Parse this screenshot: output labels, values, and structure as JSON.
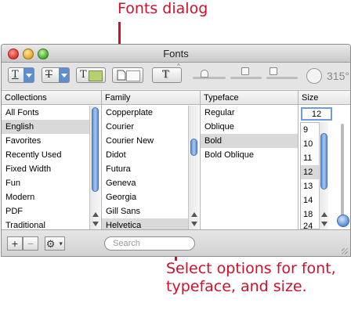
{
  "callouts": {
    "top": "Fonts dialog",
    "bottom_line1": "Select options for font,",
    "bottom_line2": "typeface, and size."
  },
  "window": {
    "title": "Fonts"
  },
  "toolbar": {
    "underline_glyph": "T",
    "strike_glyph": "T",
    "text_color_glyph": "T",
    "shadow_glyph": "T",
    "text_color_swatch": "#b3d36e",
    "angle_readout": "315°"
  },
  "columns": {
    "collections": {
      "header": "Collections",
      "items": [
        "All Fonts",
        "English",
        "Favorites",
        "Recently Used",
        "Fixed Width",
        "Fun",
        "Modern",
        "PDF",
        "Traditional"
      ],
      "selected": "English"
    },
    "family": {
      "header": "Family",
      "items": [
        "Copperplate",
        "Courier",
        "Courier New",
        "Didot",
        "Futura",
        "Geneva",
        "Georgia",
        "Gill Sans",
        "Helvetica"
      ],
      "selected": "Helvetica"
    },
    "typeface": {
      "header": "Typeface",
      "items": [
        "Regular",
        "Oblique",
        "Bold",
        "Bold Oblique"
      ],
      "selected": "Bold"
    },
    "size": {
      "header": "Size",
      "value": "12",
      "items": [
        "9",
        "10",
        "11",
        "12",
        "13",
        "14",
        "18",
        "24"
      ],
      "selected": "12"
    }
  },
  "bottom": {
    "add_label": "+",
    "remove_label": "−",
    "search_placeholder": "Search"
  },
  "colors": {
    "callout": "#d0102a",
    "selection": "#d9d9d9",
    "accent": "#5d8fd0"
  }
}
